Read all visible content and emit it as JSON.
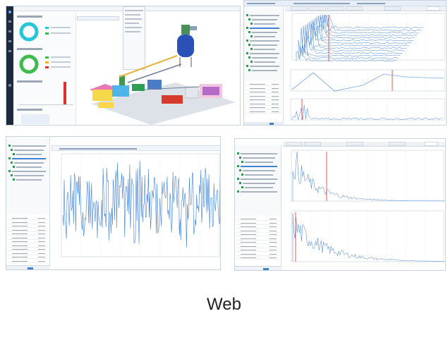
{
  "caption": "Web",
  "colors": {
    "signal_blue": "#3f82d6",
    "marker_red": "#e0302a",
    "tree_green": "#2e9b4f",
    "ring_cyan": "#27c5d8",
    "ring_green": "#3dbb4d",
    "nav_dark": "#1d2a3b"
  },
  "dashboard": {
    "nav_icons": [
      "home-icon",
      "chart-icon",
      "device-icon",
      "alarm-icon",
      "settings-icon",
      "user-icon"
    ],
    "section_titles_illegible": 4,
    "machine_model": "3d-plant-model"
  },
  "spectrum_3d": {
    "tree_items": 14,
    "table_rows": 8
  },
  "waveform": {
    "tree_items": 9,
    "table_rows": 12
  },
  "spectrum_2d": {
    "tree_items": 10,
    "table_rows": 11
  }
}
